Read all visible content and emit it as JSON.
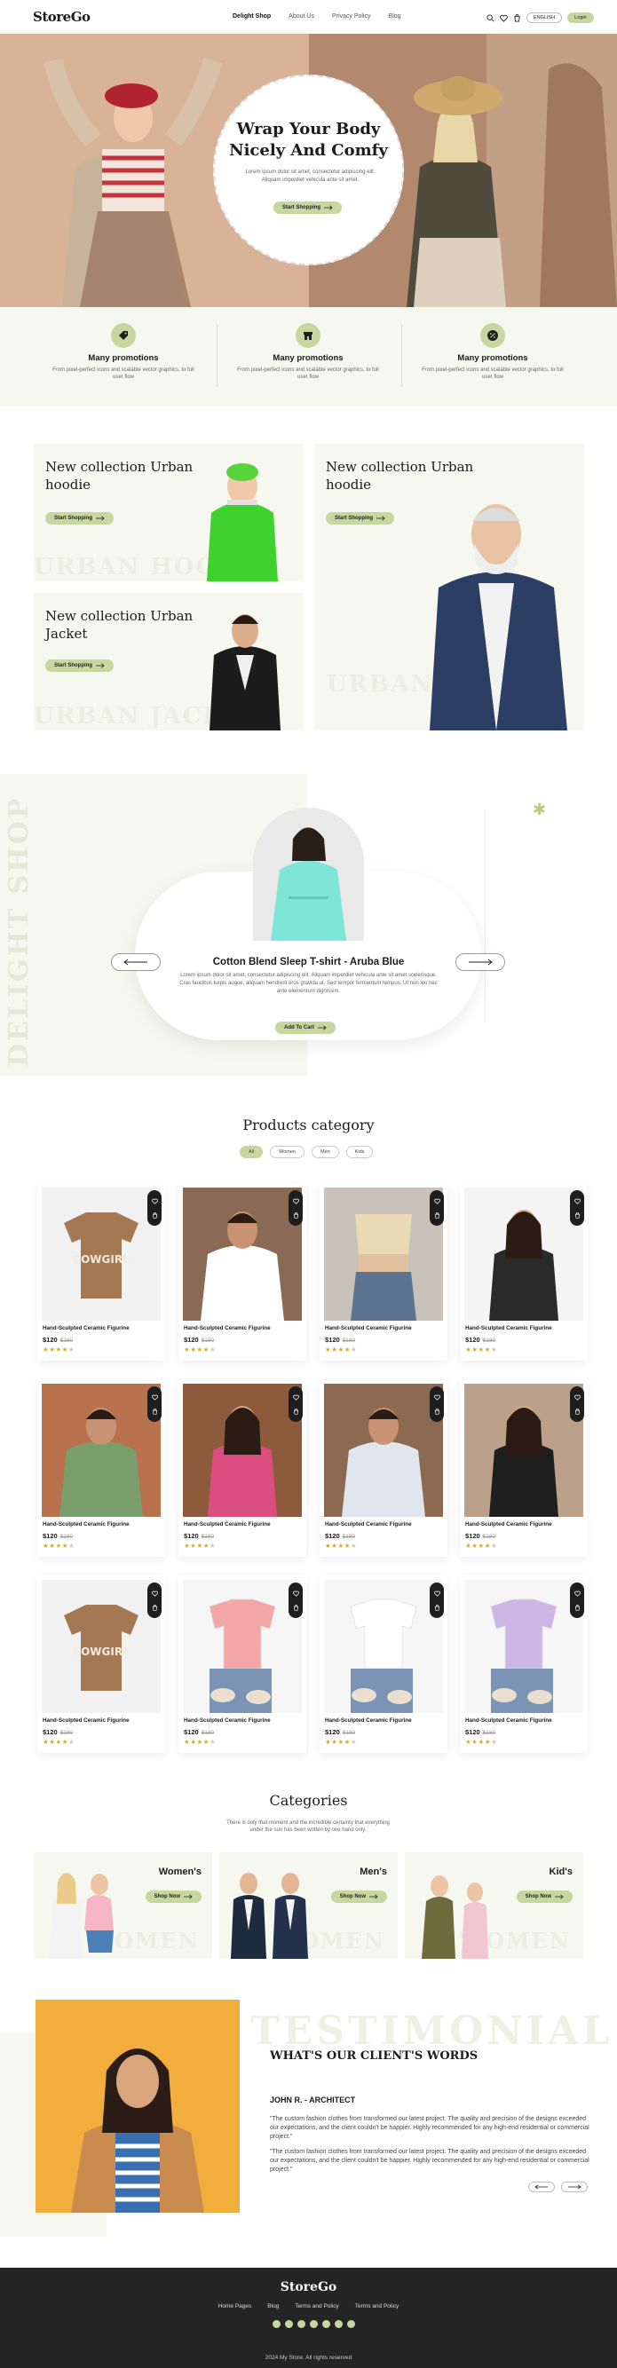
{
  "brand": "StoreGo",
  "nav": {
    "links": [
      "Delight Shop",
      "About Us",
      "Privacy Policy",
      "Blog"
    ],
    "language": "ENGLISH",
    "login": "Login"
  },
  "hero": {
    "title_line1": "Wrap Your Body",
    "title_line2": "Nicely And Comfy",
    "text": "Lorem ipsum dolor sit amet, consectetur adipiscing elit. Aliquam imperdiet vehicula ante sit amet.",
    "button": "Start Shopping"
  },
  "promos": [
    {
      "title": "Many promotions",
      "text": "From pixel-perfect icons and scalable vector graphics, to full user flow",
      "icon": "tag-icon"
    },
    {
      "title": "Many promotions",
      "text": "From pixel-perfect icons and scalable vector graphics, to full user flow",
      "icon": "store-icon"
    },
    {
      "title": "Many promotions",
      "text": "From pixel-perfect icons and scalable vector graphics, to full user flow",
      "icon": "percent-icon"
    }
  ],
  "collections": [
    {
      "title": "New collection Urban hoodie",
      "button": "Start Shopping",
      "watermark": "URBAN HOODIE"
    },
    {
      "title": "New collection Urban Jacket",
      "button": "Start Shopping",
      "watermark": "URBAN JACKET"
    },
    {
      "title": "New collection Urban hoodie",
      "button": "Start Shopping",
      "watermark": "URBAN T-SHIRT"
    }
  ],
  "featured": {
    "vertical": "DELIGHT SHOP",
    "name": "Cotton Blend Sleep T-shirt - Aruba Blue",
    "desc": "Lorem ipsum dolor sit amet, consectetur adipiscing elit. Aliquam imperdiet vehicula ante sit amet scelerisque. Cras faucibus turpis augue, aliquam hendrerit eros gravida ut. Sed tempor fermentum tempus. Ut non leo nec ante elementum dignissim.",
    "button": "Add To Cart"
  },
  "product_category": {
    "title": "Products category",
    "tabs": [
      "All",
      "Women",
      "Men",
      "Kids"
    ],
    "products": [
      {
        "name": "Hand-Sculpted Ceramic Figurine",
        "price": "$120",
        "old": "$180",
        "rating": 4
      },
      {
        "name": "Hand-Sculpted Ceramic Figurine",
        "price": "$120",
        "old": "$180",
        "rating": 4
      },
      {
        "name": "Hand-Sculpted Ceramic Figurine",
        "price": "$120",
        "old": "$180",
        "rating": 4
      },
      {
        "name": "Hand-Sculpted Ceramic Figurine",
        "price": "$120",
        "old": "$180",
        "rating": 4
      },
      {
        "name": "Hand-Sculpted Ceramic Figurine",
        "price": "$120",
        "old": "$180",
        "rating": 4
      },
      {
        "name": "Hand-Sculpted Ceramic Figurine",
        "price": "$120",
        "old": "$180",
        "rating": 4
      },
      {
        "name": "Hand-Sculpted Ceramic Figurine",
        "price": "$120",
        "old": "$180",
        "rating": 4
      },
      {
        "name": "Hand-Sculpted Ceramic Figurine",
        "price": "$120",
        "old": "$180",
        "rating": 4
      },
      {
        "name": "Hand-Sculpted Ceramic Figurine",
        "price": "$120",
        "old": "$180",
        "rating": 4
      },
      {
        "name": "Hand-Sculpted Ceramic Figurine",
        "price": "$120",
        "old": "$180",
        "rating": 4
      },
      {
        "name": "Hand-Sculpted Ceramic Figurine",
        "price": "$120",
        "old": "$180",
        "rating": 4
      },
      {
        "name": "Hand-Sculpted Ceramic Figurine",
        "price": "$120",
        "old": "$180",
        "rating": 4
      }
    ]
  },
  "categories": {
    "title": "Categories",
    "subtitle": "There is only that moment and the incredible certainty that everything under the sun has been written by one hand only.",
    "items": [
      {
        "title": "Women's",
        "button": "Shop Now",
        "watermark": "WOMEN"
      },
      {
        "title": "Men's",
        "button": "Shop Now",
        "watermark": "WOMEN"
      },
      {
        "title": "Kid's",
        "button": "Shop Now",
        "watermark": "WOMEN"
      }
    ]
  },
  "testimonial": {
    "watermark": "TESTIMONIAL",
    "heading": "WHAT'S OUR CLIENT'S WORDS",
    "name": "JOHN R. - ARCHITECT",
    "quote1": "\"The custom fashion clothes from transformed our latest project. The quality and precision of the designs exceeded our expectations, and the client couldn't be happier. Highly recommended for any high-end residential or commercial project.\"",
    "quote2": "\"The custom fashion clothes from transformed our latest project. The quality and precision of the designs exceeded our expectations, and the client couldn't be happier. Highly recommended for any high-end residential or commercial project.\""
  },
  "footer": {
    "links": [
      "Home Pages",
      "Blog",
      "Terms and Policy",
      "Terms and Policy"
    ],
    "copyright": "2024 My Store. All rights reserved"
  },
  "colors": {
    "accent": "#c7d79f",
    "cream": "#f6f7ee",
    "dark": "#242424"
  }
}
